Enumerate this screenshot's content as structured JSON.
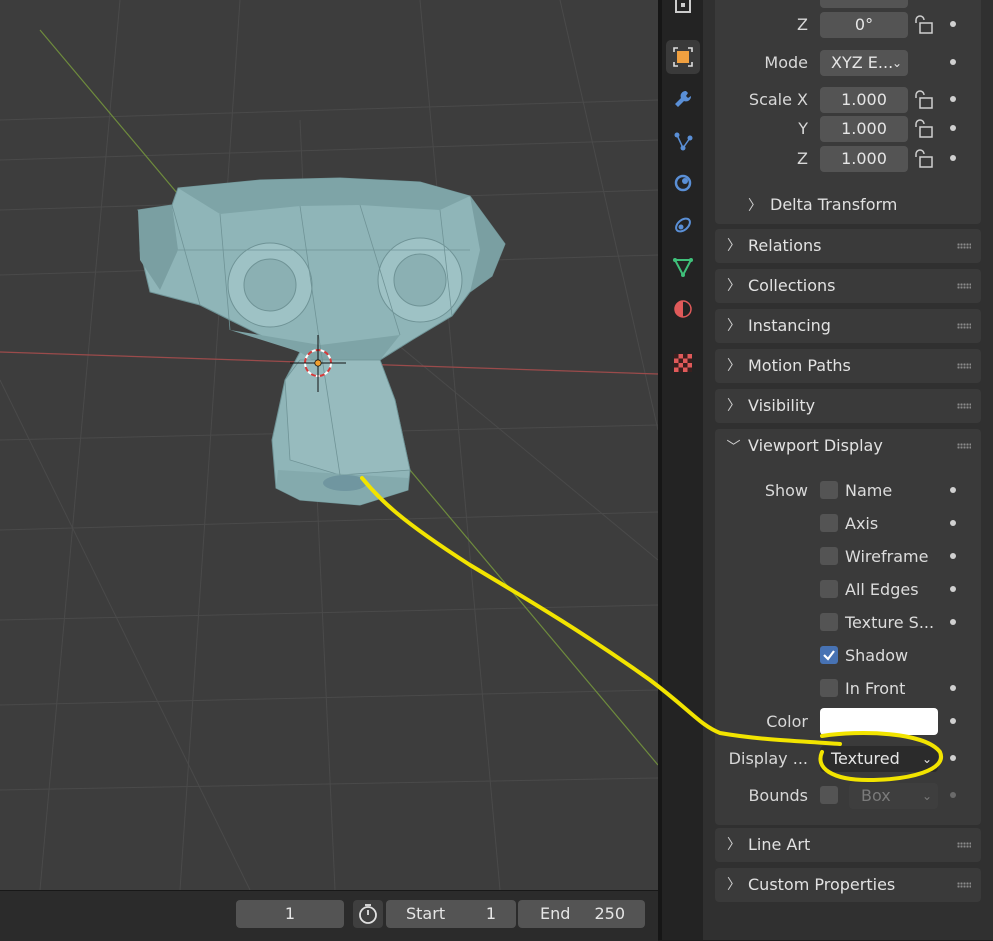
{
  "viewport": {
    "annotation_color": "#f2e400",
    "mesh_color": "#8fb5b8"
  },
  "timeline": {
    "current_frame": "1",
    "start_label": "Start",
    "start_value": "1",
    "end_label": "End",
    "end_value": "250"
  },
  "tabs": [
    "tool",
    "object",
    "modifier",
    "particles",
    "physics",
    "constraints",
    "data",
    "material",
    "texture"
  ],
  "transform": {
    "rotation_z_label": "Z",
    "rotation_z_value": "0°",
    "mode_label": "Mode",
    "mode_value": "XYZ E...",
    "scale_x_label": "Scale X",
    "scale_x_value": "1.000",
    "scale_y_label": "Y",
    "scale_y_value": "1.000",
    "scale_z_label": "Z",
    "scale_z_value": "1.000",
    "delta_transform": "Delta Transform"
  },
  "panels": {
    "relations": "Relations",
    "collections": "Collections",
    "instancing": "Instancing",
    "motion_paths": "Motion Paths",
    "visibility": "Visibility",
    "viewport_display": "Viewport Display",
    "line_art": "Line Art",
    "custom_properties": "Custom Properties"
  },
  "viewport_display": {
    "show_label": "Show",
    "name": "Name",
    "axis": "Axis",
    "wireframe": "Wireframe",
    "all_edges": "All Edges",
    "texture_space": "Texture S...",
    "shadow": "Shadow",
    "in_front": "In Front",
    "shadow_checked": true,
    "color_label": "Color",
    "color_value": "#ffffff",
    "display_as_label": "Display ...",
    "display_as_value": "Textured",
    "bounds_label": "Bounds",
    "bounds_value": "Box"
  }
}
